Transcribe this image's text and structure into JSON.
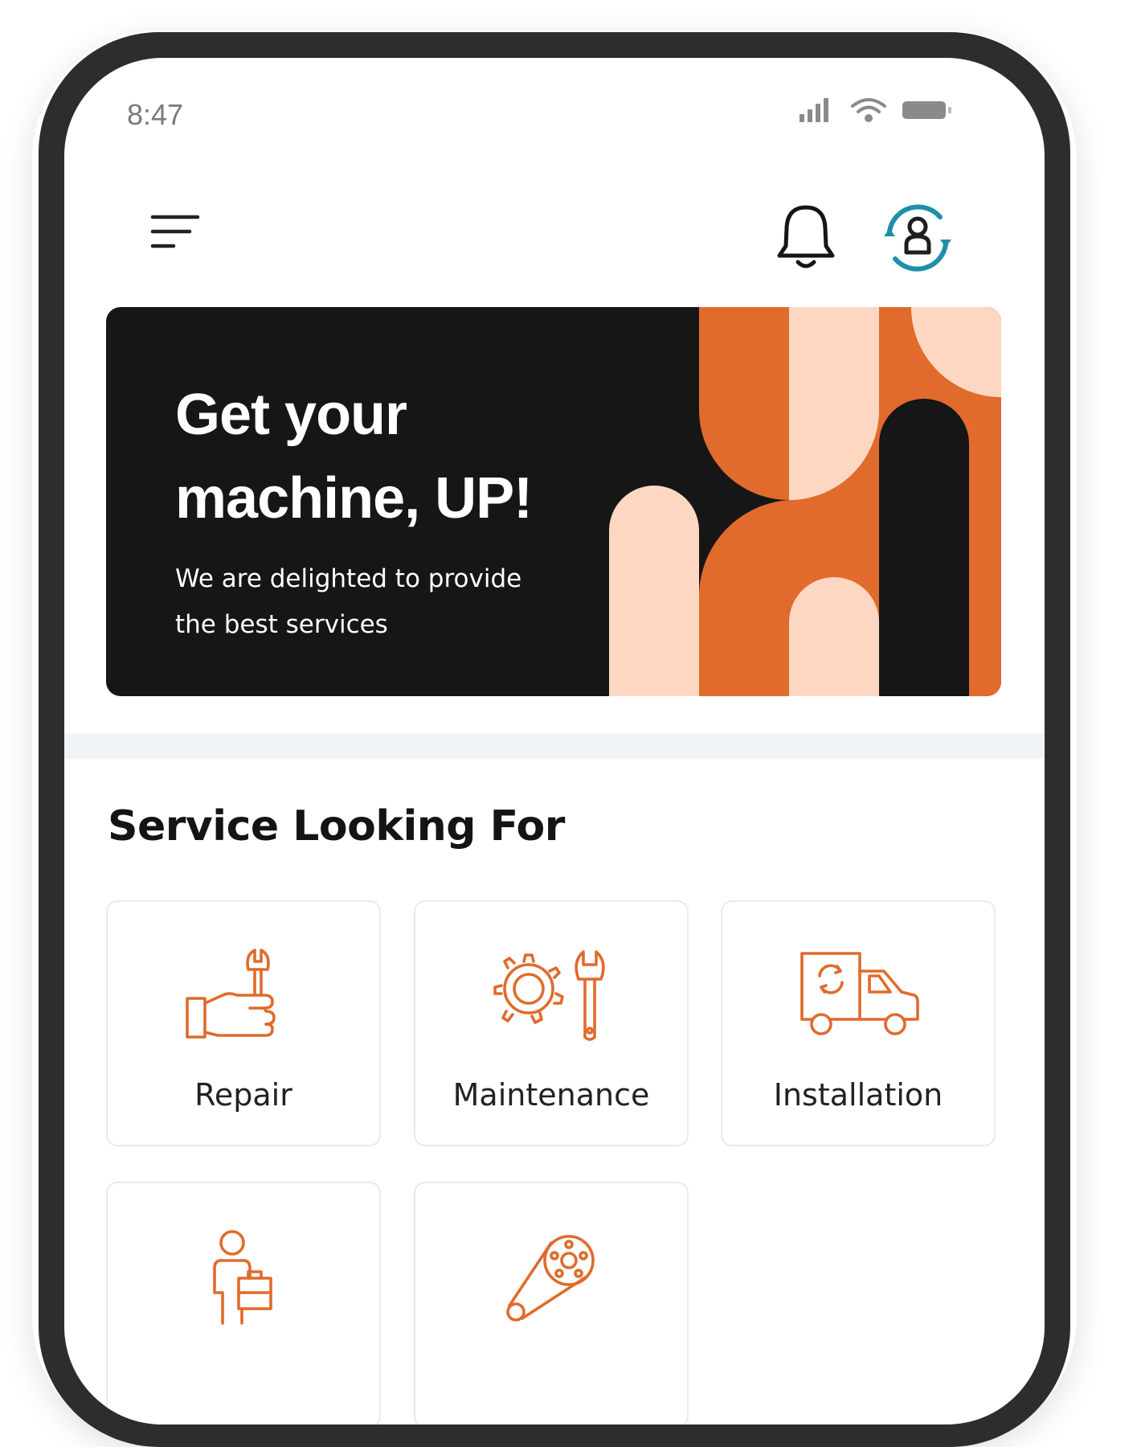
{
  "status_bar": {
    "time": "8:47"
  },
  "icons": {
    "menu": "menu-icon",
    "notification": "bell-icon",
    "profile": "profile-switch-icon"
  },
  "banner": {
    "title": "Get your machine, UP!",
    "subtitle": "We are delighted to provide the best services",
    "colors": {
      "background": "#161616",
      "orange": "#e06b2c",
      "peach": "#fdd7c2"
    }
  },
  "services": {
    "title": "Service Looking For",
    "items": [
      {
        "label": "Repair",
        "icon": "hand-wrench-icon"
      },
      {
        "label": "Maintenance",
        "icon": "gear-wrench-icon"
      },
      {
        "label": "Installation",
        "icon": "delivery-truck-icon"
      },
      {
        "label": "",
        "icon": "technician-toolbox-icon"
      },
      {
        "label": "",
        "icon": "belt-pulley-icon"
      }
    ]
  },
  "colors": {
    "accent": "#e06b2c",
    "teal": "#1e8fa8",
    "text": "#141414"
  }
}
